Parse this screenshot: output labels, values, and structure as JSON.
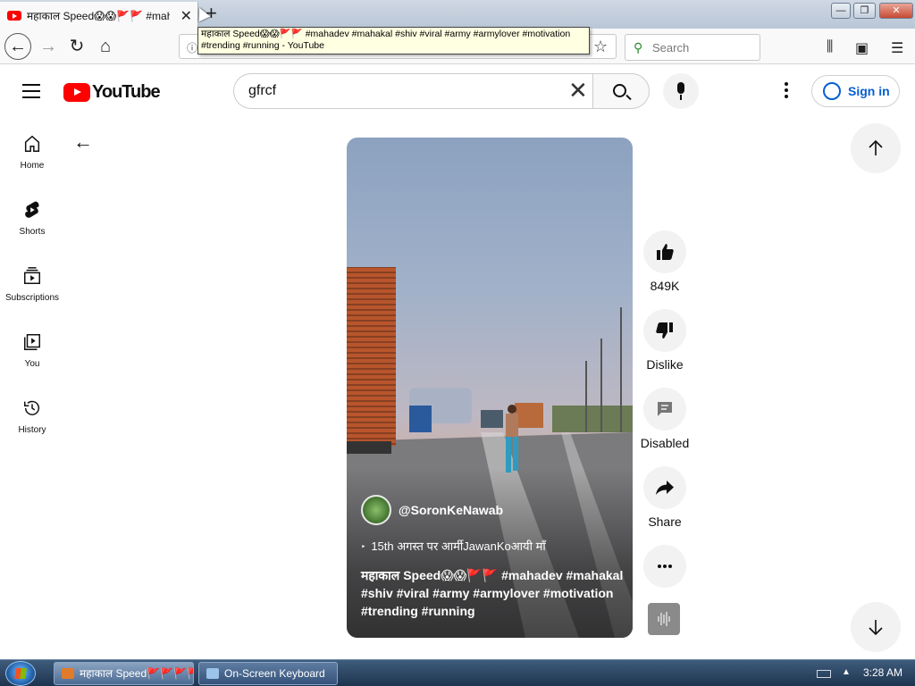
{
  "browser": {
    "tab_title": "महाकाल Speed😱😱🚩🚩 #mahadev",
    "tooltip": "महाकाल Speed😱😱🚩🚩 #mahadev #mahakal #shiv #viral #army #armylover #motivation #trending #running - YouTube",
    "new_tab": "+",
    "search_placeholder": "Search",
    "window_controls": {
      "minimize": "—",
      "maximize": "❐",
      "close": "✕"
    }
  },
  "youtube": {
    "logo_text": "YouTube",
    "search_query": "gfrcf",
    "sign_in": "Sign in",
    "sidebar": [
      {
        "label": "Home",
        "icon": "home-icon"
      },
      {
        "label": "Shorts",
        "icon": "shorts-icon"
      },
      {
        "label": "Subscriptions",
        "icon": "subscriptions-icon"
      },
      {
        "label": "You",
        "icon": "you-icon"
      },
      {
        "label": "History",
        "icon": "history-icon"
      }
    ],
    "short": {
      "channel": "@SoronKeNawab",
      "subtitle": "15th अगस्त पर आर्मीJawanKoआयी माँ",
      "caption": "महाकाल Speed😱😱🚩🚩 #mahadev #mahakal #shiv #viral #army #armylover #motivation #trending #running"
    },
    "actions": {
      "like_count": "849K",
      "dislike": "Dislike",
      "comments": "Disabled",
      "share": "Share"
    }
  },
  "taskbar": {
    "firefox_task": "महाकाल Speed🚩🚩🚩🚩...",
    "osk_task": "On-Screen Keyboard",
    "clock": "3:28 AM"
  }
}
